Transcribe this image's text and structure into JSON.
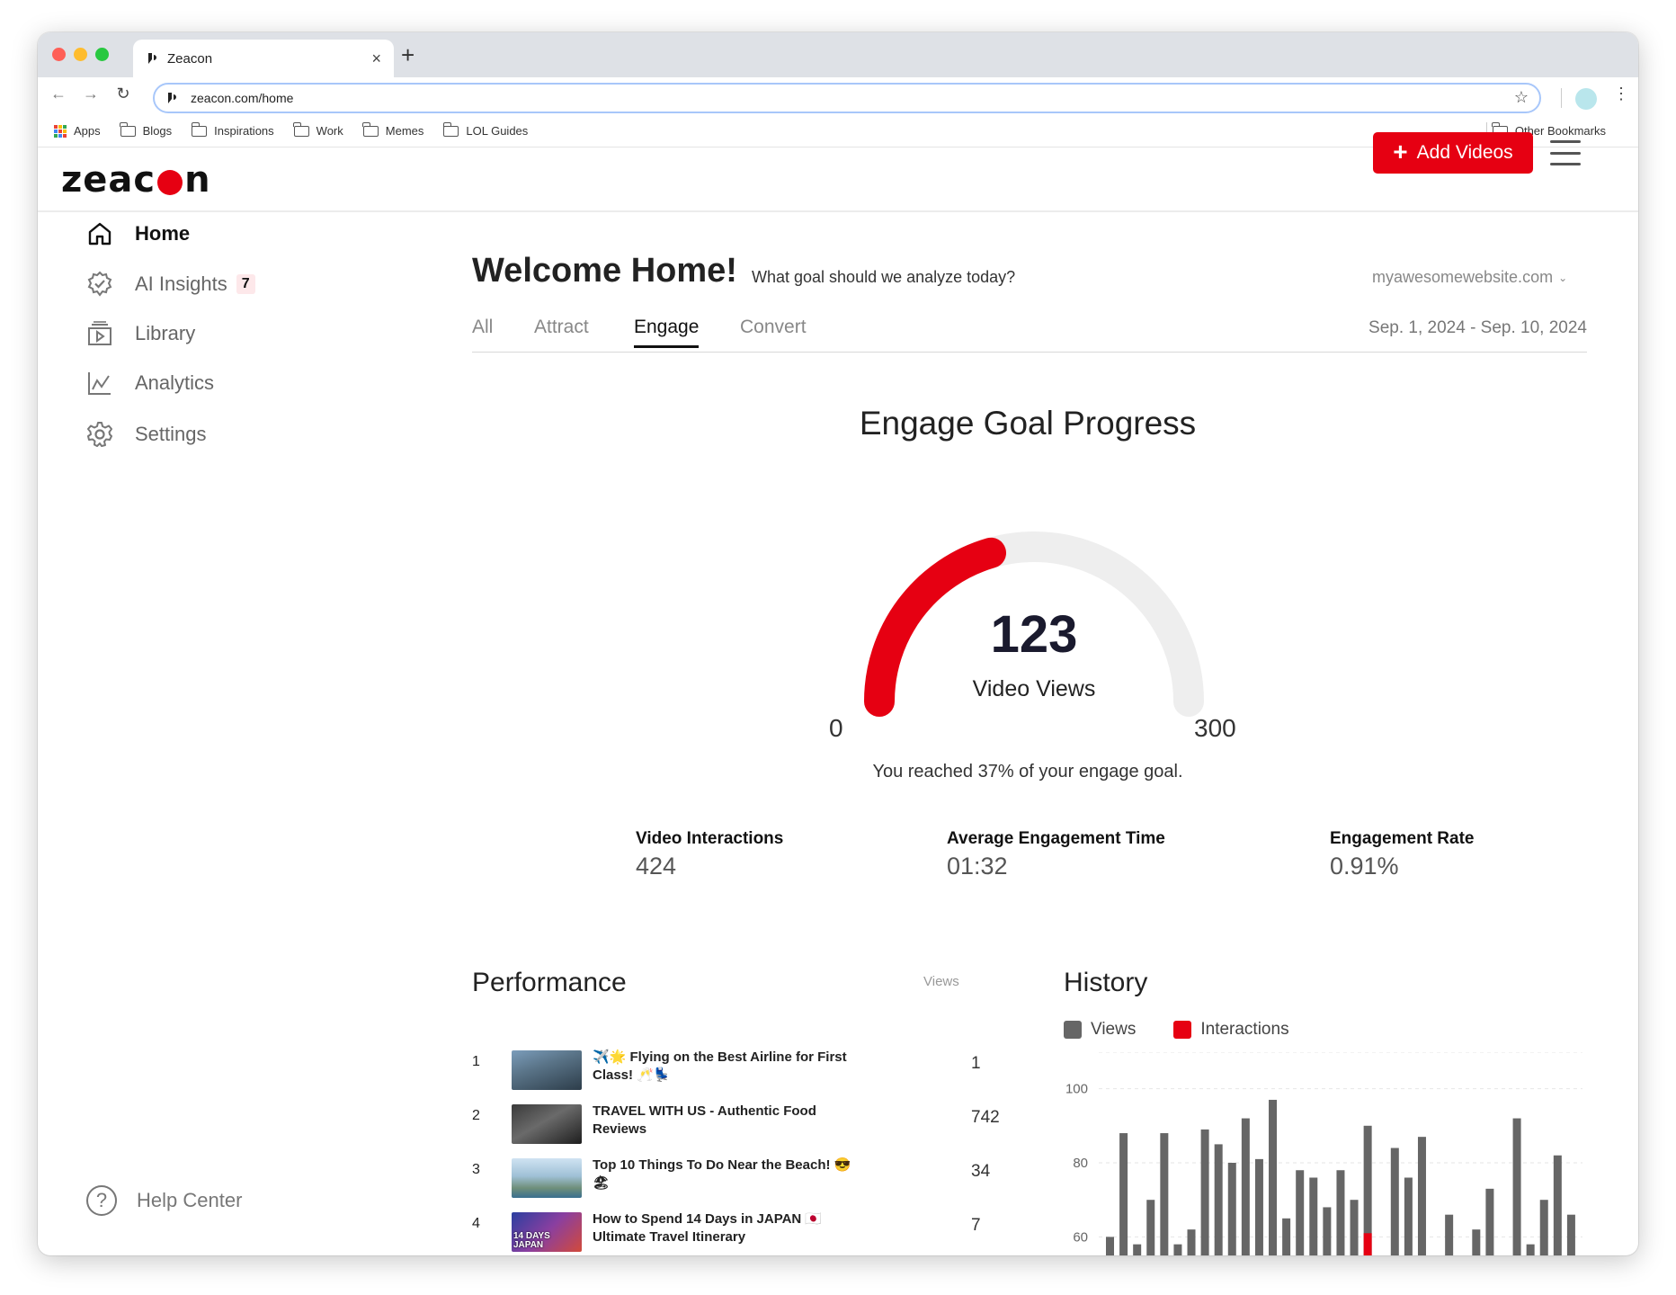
{
  "browser": {
    "tab_title": "Zeacon",
    "url": "zeacon.com/home",
    "bookmarks": [
      {
        "label": "Apps"
      },
      {
        "label": "Blogs"
      },
      {
        "label": "Inspirations"
      },
      {
        "label": "Work"
      },
      {
        "label": "Memes"
      },
      {
        "label": "LOL Guides"
      }
    ],
    "other_bookmarks": "Other Bookmarks"
  },
  "header": {
    "logo_left": "zeac",
    "logo_right": "n",
    "add_videos_label": "Add Videos",
    "brand_color": "#e60012"
  },
  "sidebar": {
    "items": [
      {
        "label": "Home",
        "icon": "home-icon",
        "active": true
      },
      {
        "label": "AI Insights",
        "icon": "insights-icon",
        "badge": "7"
      },
      {
        "label": "Library",
        "icon": "library-icon"
      },
      {
        "label": "Analytics",
        "icon": "analytics-icon"
      },
      {
        "label": "Settings",
        "icon": "gear-icon"
      }
    ],
    "help_label": "Help Center"
  },
  "main": {
    "welcome_title": "Welcome Home!",
    "welcome_sub": "What goal should we analyze today?",
    "site": "myawesomewebsite.com",
    "tabs": [
      {
        "label": "All"
      },
      {
        "label": "Attract"
      },
      {
        "label": "Engage",
        "active": true
      },
      {
        "label": "Convert"
      }
    ],
    "date_range": "Sep. 1, 2024 - Sep. 10, 2024",
    "gauge": {
      "title": "Engage Goal Progress",
      "value": "123",
      "value_num": 123,
      "label": "Video Views",
      "min": "0",
      "max": "300",
      "max_num": 300,
      "note": "You reached 37% of your engage goal."
    },
    "stats": [
      {
        "label": "Video Interactions",
        "value": "424"
      },
      {
        "label": "Average Engagement Time",
        "value": "01:32"
      },
      {
        "label": "Engagement Rate",
        "value": "0.91%"
      }
    ],
    "performance": {
      "title": "Performance",
      "views_header": "Views",
      "rows": [
        {
          "rank": "1",
          "title": "✈️🌟 Flying on the Best Airline for First Class! 🥂💺",
          "views": "1"
        },
        {
          "rank": "2",
          "title": "TRAVEL WITH US - Authentic Food Reviews",
          "views": "742"
        },
        {
          "rank": "3",
          "title": "Top 10 Things To Do Near the Beach! 😎🏖",
          "views": "34"
        },
        {
          "rank": "4",
          "title": "How to Spend 14 Days in JAPAN 🇯🇵 Ultimate Travel Itinerary",
          "views": "7",
          "thumb_text": "14 DAYS JAPAN"
        }
      ]
    },
    "history": {
      "title": "History",
      "legend": [
        {
          "label": "Views",
          "color": "#666666"
        },
        {
          "label": "Interactions",
          "color": "#e60012"
        }
      ]
    }
  },
  "chart_data": {
    "type": "bar",
    "title": "History",
    "y_ticks": [
      "100",
      "80",
      "60"
    ],
    "ylim": [
      55,
      105
    ],
    "series": [
      {
        "name": "Views",
        "values": [
          60,
          88,
          58,
          70,
          88,
          58,
          62,
          89,
          85,
          80,
          92,
          81,
          97,
          65,
          78,
          76,
          68,
          78,
          70,
          90,
          0,
          84,
          76,
          87,
          0,
          66,
          0,
          62,
          73,
          0,
          92,
          58,
          70,
          82,
          66
        ]
      },
      {
        "name": "Interactions",
        "values": [
          0,
          0,
          0,
          0,
          0,
          0,
          0,
          0,
          0,
          0,
          0,
          0,
          0,
          0,
          0,
          0,
          0,
          0,
          0,
          61,
          0,
          0,
          0,
          0,
          0,
          0,
          0,
          0,
          0,
          0,
          0,
          0,
          0,
          0,
          0
        ]
      }
    ]
  }
}
